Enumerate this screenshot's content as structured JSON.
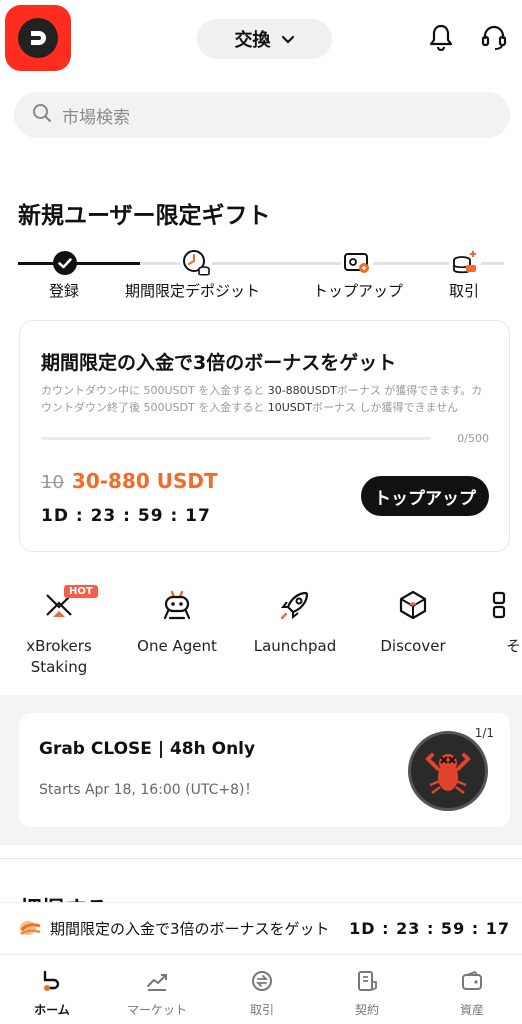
{
  "header": {
    "exchange_label": "交換",
    "search_placeholder": "市場検索",
    "icons": [
      "app-logo",
      "chevron-down-icon",
      "bell-icon",
      "support-headset-icon",
      "search-icon"
    ]
  },
  "gift": {
    "title": "新規ユーザー限定ギフト",
    "steps": [
      {
        "label": "登録",
        "icon": "check-circle-icon",
        "done": true
      },
      {
        "label": "期間限定デポジット",
        "icon": "clock-coins-icon",
        "done": false
      },
      {
        "label": "トップアップ",
        "icon": "wallet-card-icon",
        "done": false
      },
      {
        "label": "取引",
        "icon": "coin-stack-icon",
        "done": false
      }
    ]
  },
  "promo": {
    "title": "期間限定の入金で3倍のボーナスをゲット",
    "desc_1": "カウントダウン中に 500USDT を入金すると ",
    "desc_b1": "30-880USDT",
    "desc_2": "ボーナス が獲得できます。カウントダウン終了後 500USDT を入金すると ",
    "desc_b2": "10USDT",
    "desc_3": "ボーナス しか獲得できません",
    "progress_label": "0/500",
    "progress_fraction": 0,
    "reward_old": "10",
    "reward_new": "30-880 USDT",
    "countdown": "1D : 23 : 59 : 17",
    "button": "トップアップ",
    "accent_color": "#f26b2a"
  },
  "shortcuts": [
    {
      "label": "xBrokers\nStaking",
      "icon": "xbrokers-icon",
      "badge": "HOT"
    },
    {
      "label": "One Agent",
      "icon": "robot-agent-icon"
    },
    {
      "label": "Launchpad",
      "icon": "rocket-icon"
    },
    {
      "label": "Discover",
      "icon": "cube-icon"
    },
    {
      "label": "そ",
      "icon": "grid-icon"
    }
  ],
  "event": {
    "title": "Grab CLOSE | 48h Only",
    "subtitle": "Starts Apr 18, 16:00 (UTC+8)！",
    "page": "1/1",
    "image": "lobster-token-icon"
  },
  "partial_title": "把握する",
  "banner": {
    "text": "期間限定の入金で3倍のボーナスをゲット",
    "timer": "1D : 23 : 59 : 17",
    "icon": "coin-gift-icon"
  },
  "tabs": [
    {
      "label": "ホーム",
      "icon": "home-icon",
      "active": true
    },
    {
      "label": "マーケット",
      "icon": "chart-line-icon",
      "active": false
    },
    {
      "label": "取引",
      "icon": "trade-cycle-icon",
      "active": false
    },
    {
      "label": "契約",
      "icon": "contract-doc-icon",
      "active": false
    },
    {
      "label": "資産",
      "icon": "wallet-icon",
      "active": false
    }
  ]
}
